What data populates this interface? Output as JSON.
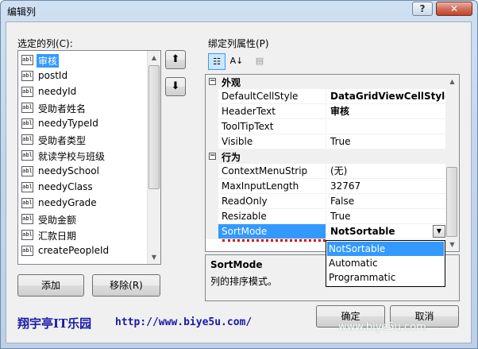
{
  "window": {
    "title": "编辑列",
    "help_label": "?",
    "close_label": "✕"
  },
  "left": {
    "label": "选定的列(C):",
    "icon_text": "abl",
    "items": [
      {
        "label": "审核",
        "selected": true
      },
      {
        "label": "postId"
      },
      {
        "label": "needyId"
      },
      {
        "label": "受助者姓名"
      },
      {
        "label": "needyTypeId"
      },
      {
        "label": "受助者类型"
      },
      {
        "label": "就读学校与班级"
      },
      {
        "label": "needySchool"
      },
      {
        "label": "needyClass"
      },
      {
        "label": "needyGrade"
      },
      {
        "label": "受助金额"
      },
      {
        "label": "汇款日期"
      },
      {
        "label": "createPeopleId"
      }
    ],
    "add_label": "添加",
    "remove_label": "移除(R)"
  },
  "right": {
    "label": "绑定列属性(P)",
    "categories": [
      {
        "name": "外观",
        "rows": [
          {
            "name": "DefaultCellStyle",
            "value": "DataGridViewCellStyle {",
            "bold": true
          },
          {
            "name": "HeaderText",
            "value": "审核",
            "bold": true
          },
          {
            "name": "ToolTipText",
            "value": ""
          },
          {
            "name": "Visible",
            "value": "True"
          }
        ]
      },
      {
        "name": "行为",
        "rows": [
          {
            "name": "ContextMenuStrip",
            "value": "(无)"
          },
          {
            "name": "MaxInputLength",
            "value": "32767"
          },
          {
            "name": "ReadOnly",
            "value": "False"
          },
          {
            "name": "Resizable",
            "value": "True"
          },
          {
            "name": "SortMode",
            "value": "NotSortable",
            "bold": true,
            "selected": true
          }
        ]
      }
    ],
    "dropdown_options": [
      "NotSortable",
      "Automatic",
      "Programmatic"
    ],
    "description": {
      "title": "SortMode",
      "text": "列的排序模式。"
    }
  },
  "footer": {
    "brand": "翔宇亭IT乐园",
    "url": "http://www.biye5u.com/",
    "ok_label": "确定",
    "cancel_label": "取消",
    "watermark": "www.biye5u.com"
  },
  "icons": {
    "move_up": "arrow-up-icon",
    "move_down": "arrow-down-icon",
    "categorized": "categorized-icon",
    "alphabetical": "alphabetical-sort-icon",
    "property_pages": "property-pages-icon"
  }
}
